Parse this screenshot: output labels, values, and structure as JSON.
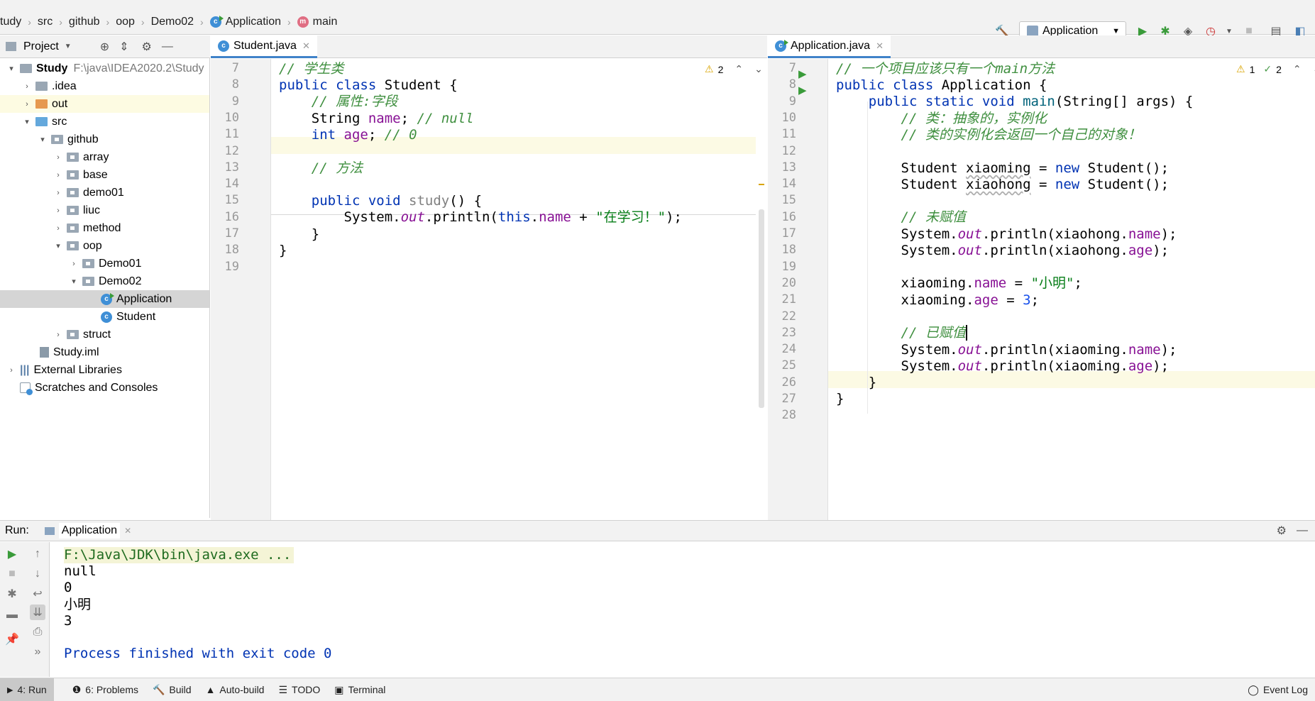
{
  "breadcrumb": [
    "tudy",
    "src",
    "github",
    "oop",
    "Demo02",
    "Application",
    "main"
  ],
  "toolbar": {
    "run_config": "Application"
  },
  "project": {
    "title": "Project",
    "tree": [
      {
        "label": "Study",
        "extra": "F:\\java\\IDEA2020.2\\Study"
      },
      {
        "label": ".idea"
      },
      {
        "label": "out"
      },
      {
        "label": "src"
      },
      {
        "label": "github"
      },
      {
        "label": "array"
      },
      {
        "label": "base"
      },
      {
        "label": "demo01"
      },
      {
        "label": "liuc"
      },
      {
        "label": "method"
      },
      {
        "label": "oop"
      },
      {
        "label": "Demo01"
      },
      {
        "label": "Demo02"
      },
      {
        "label": "Application"
      },
      {
        "label": "Student"
      },
      {
        "label": "struct"
      },
      {
        "label": "Study.iml"
      },
      {
        "label": "External Libraries"
      },
      {
        "label": "Scratches and Consoles"
      }
    ]
  },
  "left_editor": {
    "tab": "Student.java",
    "warnings": "2",
    "line_numbers": [
      "7",
      "8",
      "9",
      "10",
      "11",
      "12",
      "13",
      "14",
      "15",
      "16",
      "17",
      "18",
      "19"
    ]
  },
  "right_editor": {
    "tab": "Application.java",
    "warnings": "1",
    "weak_warnings": "2",
    "line_numbers": [
      "7",
      "8",
      "9",
      "10",
      "11",
      "12",
      "13",
      "14",
      "15",
      "16",
      "17",
      "18",
      "19",
      "20",
      "21",
      "22",
      "23",
      "24",
      "25",
      "26",
      "27",
      "28"
    ]
  },
  "run": {
    "label": "Run:",
    "tab": "Application",
    "output": [
      "F:\\Java\\JDK\\bin\\java.exe ...",
      "null",
      "0",
      "小明",
      "3",
      "",
      "Process finished with exit code 0"
    ]
  },
  "statusbar": {
    "run": "4: Run",
    "problems": "6: Problems",
    "build": "Build",
    "autobuild": "Auto-build",
    "todo": "TODO",
    "terminal": "Terminal",
    "eventlog": "Event Log"
  },
  "colors": {
    "accent": "#4083c9",
    "keyword": "#0033b3",
    "comment": "#3f8f3f",
    "field": "#871094",
    "string": "#067d17"
  }
}
